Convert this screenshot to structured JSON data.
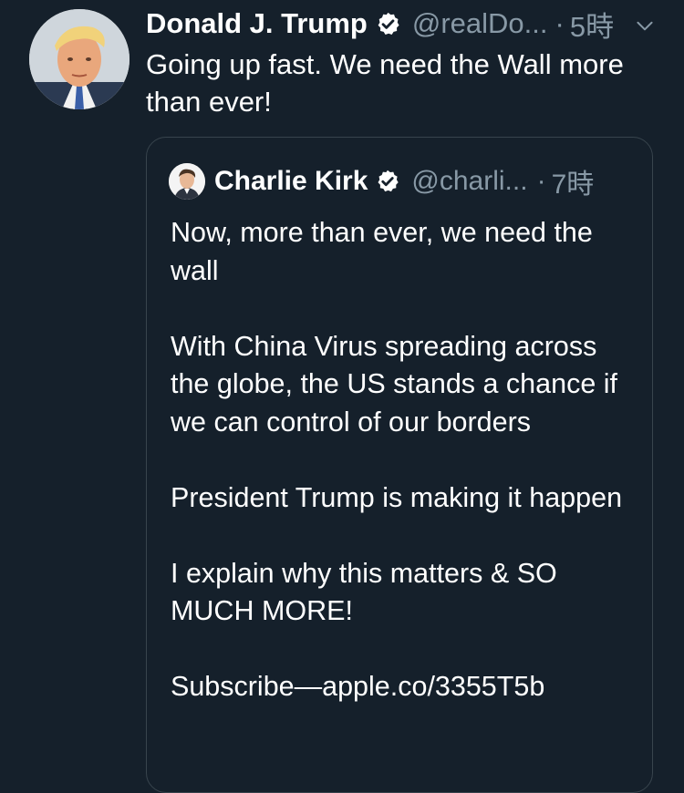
{
  "tweet": {
    "author_name": "Donald J. Trump",
    "handle": "@realDo...",
    "separator": "·",
    "time": "5時",
    "text": "Going up fast. We need the Wall more than ever!"
  },
  "quoted_tweet": {
    "author_name": "Charlie Kirk",
    "handle": "@charli...",
    "separator": "·",
    "time": "7時",
    "paragraphs": [
      "Now, more than ever, we need the wall",
      "With China Virus spreading across the globe, the US stands a chance if we can control of our borders",
      "President Trump is making it happen",
      "I explain why this matters & SO MUCH MORE!",
      "Subscribe—apple.co/3355T5b"
    ]
  },
  "colors": {
    "background": "#15202b",
    "primary_text": "#ffffff",
    "secondary_text": "#8899a6",
    "border": "#38444d"
  },
  "icons": {
    "verified": "verified-badge-icon",
    "caret": "chevron-down-icon"
  }
}
